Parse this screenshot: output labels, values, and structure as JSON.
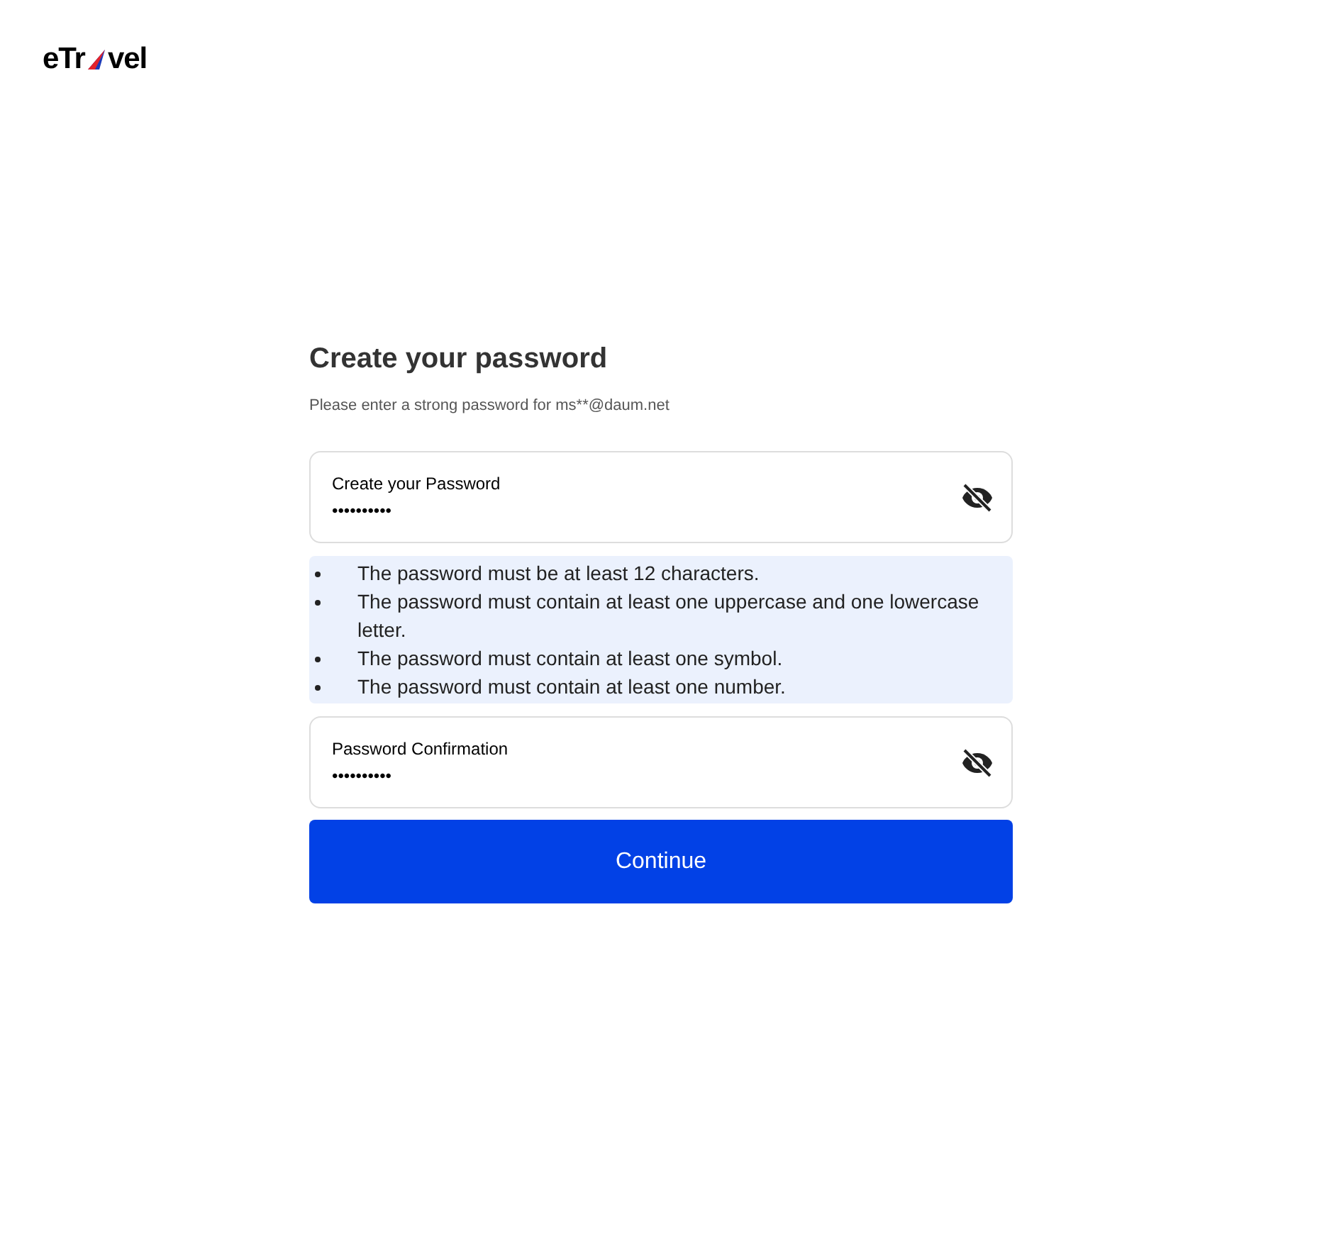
{
  "logo": {
    "before": "eTr",
    "after": "vel"
  },
  "title": "Create your password",
  "subtitle": "Please enter a strong password for ms**@daum.net",
  "fields": [
    {
      "label": "Create your Password",
      "value": "••••••••••",
      "masked": true
    },
    {
      "label": "Password Confirmation",
      "value": "••••••••••",
      "masked": true
    }
  ],
  "requirements": [
    "The password must be at least 12 characters.",
    "The password must contain at least one uppercase and one lowercase letter.",
    "The password must contain at least one symbol.",
    "The password must contain at least one number."
  ],
  "button": "Continue"
}
